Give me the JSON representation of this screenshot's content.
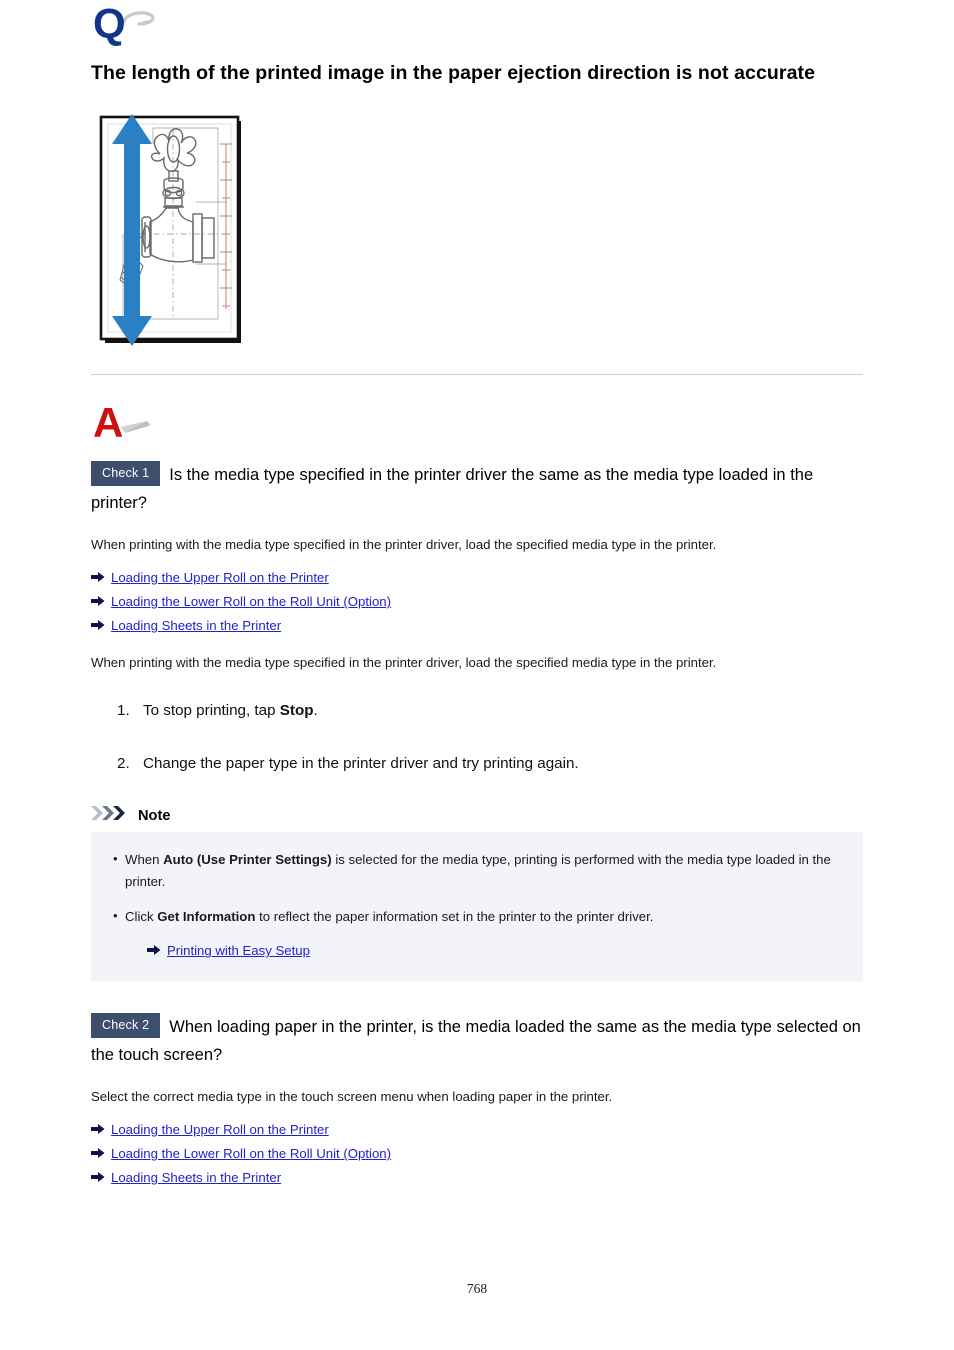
{
  "document": {
    "page_number": "768"
  },
  "question": {
    "icon": "question-q-icon",
    "title": "The length of the printed image in the paper ejection direction is not accurate"
  },
  "illustration": {
    "name": "printed-valve-drawing-with-vertical-arrow",
    "arrow_color": "#2980c4",
    "frame_color": "#111111",
    "drawing_color": "#5b5b5b",
    "alt": "Technical drawing of a valve printed on paper with a blue double-headed vertical arrow indicating the paper ejection direction"
  },
  "answer": {
    "icon": "answer-a-icon",
    "checks": [
      {
        "badge": "Check 1",
        "question": "Is the media type specified in the printer driver the same as the media type loaded in the printer?",
        "paragraph_1": "When printing with the media type specified in the printer driver, load the specified media type in the printer.",
        "links_1": [
          "Loading the Upper Roll on the Printer",
          "Loading the Lower Roll on the Roll Unit (Option)",
          "Loading Sheets in the Printer"
        ],
        "paragraph_2": "When printing with the media type specified in the printer driver, load the specified media type in the printer.",
        "steps": [
          {
            "marker": "1.",
            "text_before": "To stop printing, tap ",
            "bold": "Stop",
            "text_after": "."
          },
          {
            "marker": "2.",
            "text_before": "Change the paper type in the printer driver and try printing again.",
            "bold": "",
            "text_after": ""
          }
        ]
      },
      {
        "badge": "Check 2",
        "question": "When loading paper in the printer, is the media loaded the same as the media type selected on the touch screen?",
        "paragraph_1": "Select the correct media type in the touch screen menu when loading paper in the printer.",
        "links_1": [
          "Loading the Upper Roll on the Printer",
          "Loading the Lower Roll on the Roll Unit (Option)",
          "Loading Sheets in the Printer"
        ]
      }
    ]
  },
  "note": {
    "icon": "triple-chevron-icon",
    "label": "Note",
    "bullets": [
      {
        "text_before": "When ",
        "bold": "Auto (Use Printer Settings)",
        "text_after": " is selected for the media type, printing is performed with the media type loaded in the printer."
      },
      {
        "text_before": "Click ",
        "bold": "Get Information",
        "text_after": " to reflect the paper information set in the printer to the printer driver."
      }
    ],
    "link": "Printing with Easy Setup"
  },
  "colors": {
    "q_blue": "#0b3b8f",
    "a_red": "#cc1111",
    "badge_bg": "#3e4e6d",
    "link_blue": "#2222cc",
    "note_bg": "#f2f4fa",
    "divider": "#cfcfcf"
  }
}
